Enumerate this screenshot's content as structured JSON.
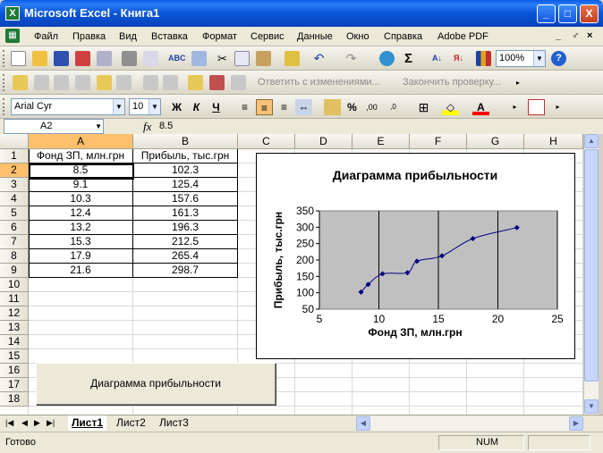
{
  "window": {
    "title": "Microsoft Excel - Книга1",
    "buttons": [
      "_",
      "□",
      "X"
    ]
  },
  "menu": {
    "items": [
      "Файл",
      "Правка",
      "Вид",
      "Вставка",
      "Формат",
      "Сервис",
      "Данные",
      "Окно",
      "Справка",
      "Adobe PDF"
    ],
    "mdi": [
      "_",
      "♂",
      "×"
    ]
  },
  "standard_toolbar": {
    "zoom": "100%"
  },
  "review_toolbar": {
    "reply": "Ответить с изменениями...",
    "end_review": "Закончить проверку..."
  },
  "formatting_toolbar": {
    "font": "Arial Cyr",
    "size": "10",
    "bold": "Ж",
    "italic": "К",
    "underline": "Ч",
    "percent": "%"
  },
  "formula_bar": {
    "name_box": "A2",
    "fx": "fx",
    "value": "8.5"
  },
  "columns": [
    "A",
    "B",
    "C",
    "D",
    "E",
    "F",
    "G",
    "H"
  ],
  "rows": [
    "1",
    "2",
    "3",
    "4",
    "5",
    "6",
    "7",
    "8",
    "9",
    "10",
    "11",
    "12",
    "13",
    "14",
    "15",
    "16",
    "17",
    "18"
  ],
  "table": {
    "headers": [
      "Фонд ЗП, млн.грн",
      "Прибыль, тыс.грн"
    ],
    "rows": [
      [
        "8.5",
        "102.3"
      ],
      [
        "9.1",
        "125.4"
      ],
      [
        "10.3",
        "157.6"
      ],
      [
        "12.4",
        "161.3"
      ],
      [
        "13.2",
        "196.3"
      ],
      [
        "15.3",
        "212.5"
      ],
      [
        "17.9",
        "265.4"
      ],
      [
        "21.6",
        "298.7"
      ]
    ]
  },
  "chart_data": {
    "type": "scatter",
    "title": "Диаграмма прибыльности",
    "xlabel": "Фонд ЗП, млн.грн",
    "ylabel": "Прибыль, тыс.грн",
    "xlim": [
      5,
      25
    ],
    "ylim": [
      50,
      350
    ],
    "xticks": [
      "5",
      "10",
      "15",
      "20",
      "25"
    ],
    "yticks": [
      "50",
      "100",
      "150",
      "200",
      "250",
      "300",
      "350"
    ],
    "grid": true,
    "plot_background": "#c0c0c0",
    "line_color": "#000080",
    "series": [
      {
        "x": [
          8.5,
          9.1,
          10.3,
          12.4,
          13.2,
          15.3,
          17.9,
          21.6
        ],
        "y": [
          102.3,
          125.4,
          157.6,
          161.3,
          196.3,
          212.5,
          265.4,
          298.7
        ]
      }
    ]
  },
  "sheet_button": "Диаграмма прибыльности",
  "sheet_tabs": [
    "Лист1",
    "Лист2",
    "Лист3"
  ],
  "status": {
    "left": "Готово",
    "num": "NUM"
  }
}
